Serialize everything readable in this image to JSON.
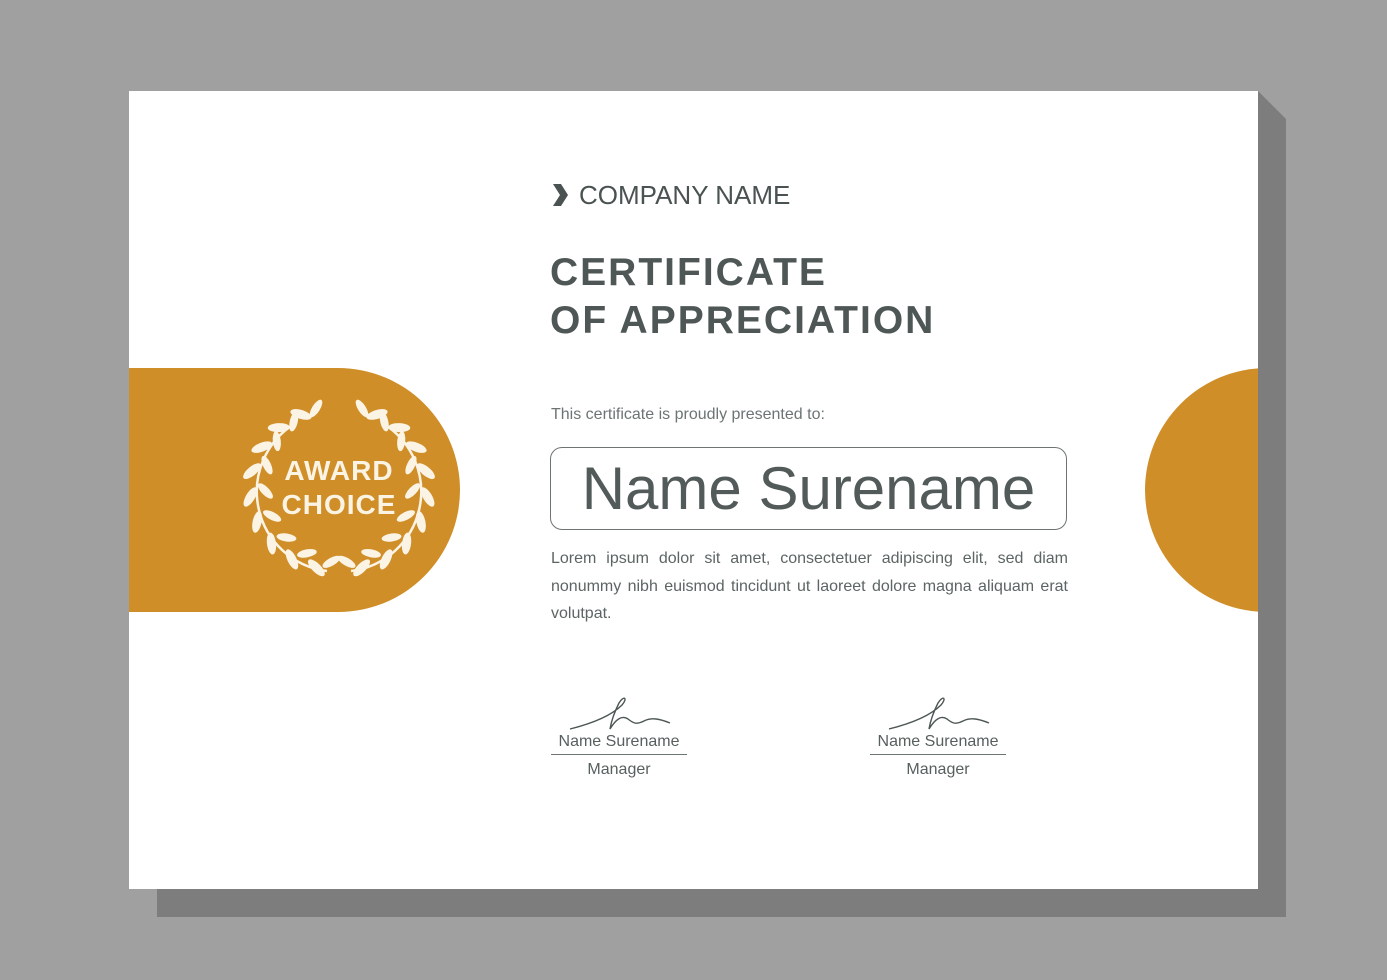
{
  "company": {
    "name": "COMPANY NAME",
    "icon": "chevron-right-icon"
  },
  "title": {
    "line1": "CERTIFICATE",
    "line2": "OF APPRECIATION"
  },
  "presented_to": "This certificate is proudly presented to:",
  "recipient": "Name Surename",
  "body": "Lorem ipsum dolor sit amet, consectetuer adipiscing elit, sed diam nonummy nibh euismod tincidunt ut laoreet dolore magna aliquam erat volutpat.",
  "seal": {
    "line1": "AWARD",
    "line2": "CHOICE",
    "icon": "laurel-wreath-icon"
  },
  "signatures": [
    {
      "name": "Name Surename",
      "role": "Manager"
    },
    {
      "name": "Name Surename",
      "role": "Manager"
    }
  ],
  "colors": {
    "accent": "#cf8e28",
    "text": "#4e5756",
    "background": "#a0a0a0",
    "paper": "#ffffff"
  }
}
